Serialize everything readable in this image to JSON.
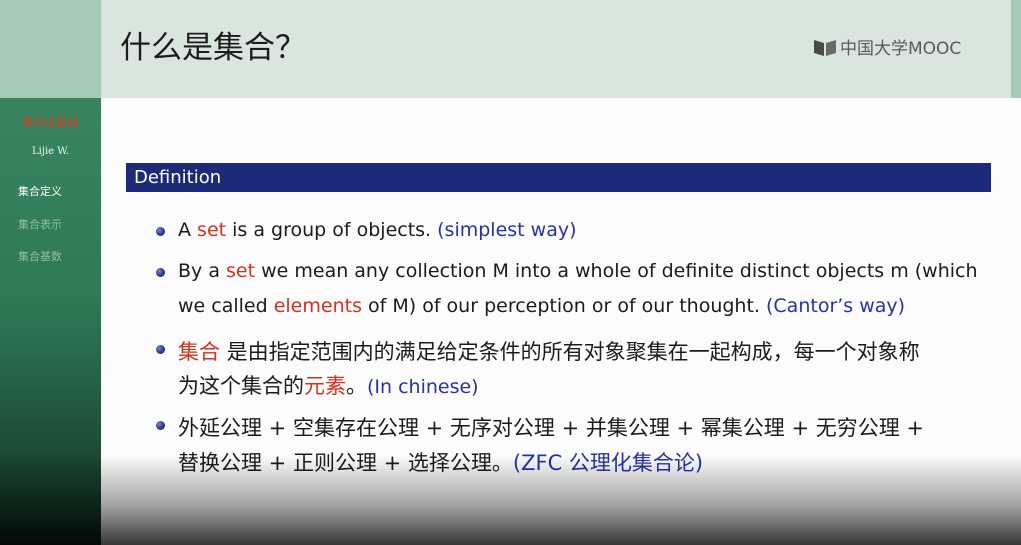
{
  "sidebar": {
    "title": "集合论基础",
    "author": "Lijie W.",
    "items": [
      {
        "label": "集合定义",
        "active": true
      },
      {
        "label": "集合表示",
        "active": false
      },
      {
        "label": "集合基数",
        "active": false
      }
    ]
  },
  "header": {
    "title": "什么是集合？",
    "logo_text": "中国大学MOOC"
  },
  "definition": {
    "heading": "Definition",
    "b1": {
      "a": "A ",
      "set": "set",
      "b": " is a group of objects. ",
      "note": "(simplest way)"
    },
    "b2": {
      "a": "By a ",
      "set": "set",
      "b": " we mean any collection M into a whole of definite distinct objects m (which",
      "c": "we called ",
      "elements": "elements",
      "d": " of M) of our perception or of our thought. ",
      "note": "(Cantor’s way)"
    },
    "b3": {
      "jihe": "集合",
      "a": " 是由指定范围内的满足给定条件的所有对象聚集在一起构成，每一个对象称",
      "b": "为这个集合的",
      "yuansu": "元素",
      "c": "。",
      "note": "(In chinese)"
    },
    "b4": {
      "line1": "外延公理 + 空集存在公理 + 无序对公理 + 并集公理 + 幂集公理 + 无穷公理 +",
      "line2": "替换公理 + 正则公理 + 选择公理。",
      "note": "(ZFC 公理化集合论)"
    }
  },
  "colors": {
    "sidebar_green": "#2f7a55",
    "header_bg": "#d9e6dd",
    "definition_bar": "#1d2a7a",
    "highlight_red": "#d8301e",
    "note_blue": "#2632a8"
  }
}
